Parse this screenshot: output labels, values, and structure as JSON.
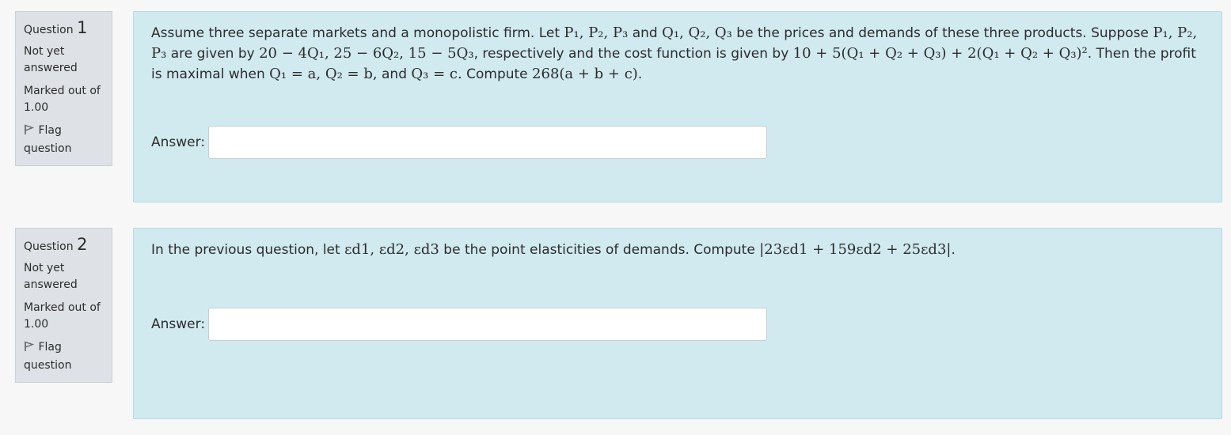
{
  "questions": [
    {
      "label": "Question",
      "number": "1",
      "state": "Not yet answered",
      "marked_out_of": "Marked out of 1.00",
      "flag_label": "Flag question",
      "answer_label": "Answer:",
      "answer_value": ""
    },
    {
      "label": "Question",
      "number": "2",
      "state": "Not yet answered",
      "marked_out_of": "Marked out of 1.00",
      "flag_label": "Flag question",
      "answer_label": "Answer:",
      "answer_value": ""
    }
  ],
  "q1_text": {
    "a": "Assume three separate markets and a monopolistic firm. Let ",
    "m1": "P₁, P₂, P₃",
    "b": " and ",
    "m2": "Q₁, Q₂, Q₃",
    "c": " be the prices and demands of these three products. Suppose ",
    "m3": "P₁, P₂, P₃",
    "d": " are given by ",
    "m4": "20 − 4Q₁, 25 − 6Q₂, 15 − 5Q₃",
    "e": ", respectively and the cost function is given by ",
    "m5": "10 + 5(Q₁ + Q₂ + Q₃) + 2(Q₁ + Q₂ + Q₃)²",
    "f": ". Then the profit is maximal when ",
    "m6": "Q₁ = a, Q₂ = b,",
    "g": " and ",
    "m7": "Q₃ = c.",
    "h": " Compute ",
    "m8": "268(a + b + c)",
    "i": "."
  },
  "q2_text": {
    "a": "In the previous question, let ",
    "m1": "εd1, εd2, εd3",
    "b": " be the point elasticities of demands. Compute ",
    "m2": "|23εd1 + 159εd2 + 25εd3|",
    "c": "."
  },
  "icons": {
    "flag": "flag-icon"
  },
  "colors": {
    "content_bg": "#d0eaf0",
    "info_bg": "#dee2e6",
    "page_bg": "#f7f7f7"
  }
}
